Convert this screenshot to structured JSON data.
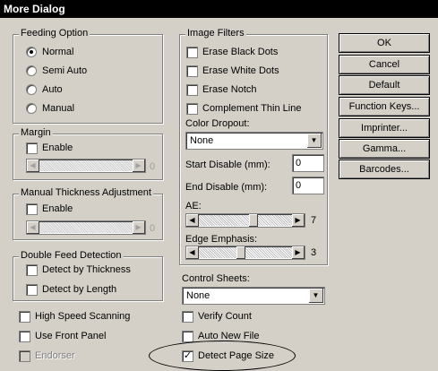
{
  "window": {
    "title": "More Dialog"
  },
  "feeding_option": {
    "title": "Feeding Option",
    "options": [
      "Normal",
      "Semi Auto",
      "Auto",
      "Manual"
    ],
    "selected": "Normal"
  },
  "margin": {
    "title": "Margin",
    "enable_label": "Enable",
    "slider_value": "0"
  },
  "manual_thickness": {
    "title": "Manual Thickness Adjustment",
    "enable_label": "Enable",
    "slider_value": "0"
  },
  "double_feed": {
    "title": "Double Feed Detection",
    "detect_thickness": "Detect by Thickness",
    "detect_length": "Detect by Length"
  },
  "left_checks": {
    "high_speed": "High Speed Scanning",
    "front_panel": "Use Front Panel",
    "endorser": "Endorser"
  },
  "image_filters": {
    "title": "Image Filters",
    "erase_black": "Erase Black Dots",
    "erase_white": "Erase White Dots",
    "erase_notch": "Erase Notch",
    "complement": "Complement Thin Line",
    "color_dropout_label": "Color Dropout:",
    "color_dropout_value": "None",
    "start_disable_label": "Start Disable (mm):",
    "start_disable_value": "0",
    "end_disable_label": "End Disable (mm):",
    "end_disable_value": "0",
    "ae_label": "AE:",
    "ae_value": "7",
    "edge_label": "Edge Emphasis:",
    "edge_value": "3"
  },
  "control_sheets": {
    "label": "Control Sheets:",
    "value": "None"
  },
  "right_checks": {
    "verify_count": "Verify Count",
    "auto_new_file": "Auto New File",
    "detect_page_size": "Detect Page Size"
  },
  "buttons": {
    "ok": "OK",
    "cancel": "Cancel",
    "default": "Default",
    "function_keys": "Function Keys...",
    "imprinter": "Imprinter...",
    "gamma": "Gamma...",
    "barcodes": "Barcodes..."
  }
}
